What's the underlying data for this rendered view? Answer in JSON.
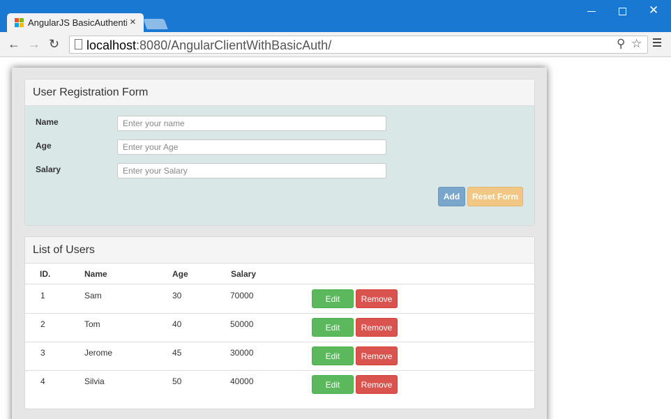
{
  "browser": {
    "tab_title": "AngularJS BasicAuthentication",
    "url_host": "localhost",
    "url_path": ":8080/AngularClientWithBasicAuth/"
  },
  "form": {
    "title": "User Registration Form",
    "fields": [
      {
        "label": "Name",
        "placeholder": "Enter your name",
        "value": ""
      },
      {
        "label": "Age",
        "placeholder": "Enter your Age",
        "value": ""
      },
      {
        "label": "Salary",
        "placeholder": "Enter your Salary",
        "value": ""
      }
    ],
    "add_label": "Add",
    "reset_label": "Reset Form"
  },
  "list": {
    "title": "List of Users",
    "columns": [
      "ID.",
      "Name",
      "Age",
      "Salary"
    ],
    "rows": [
      {
        "id": "1",
        "name": "Sam",
        "age": "30",
        "salary": "70000"
      },
      {
        "id": "2",
        "name": "Tom",
        "age": "40",
        "salary": "50000"
      },
      {
        "id": "3",
        "name": "Jerome",
        "age": "45",
        "salary": "30000"
      },
      {
        "id": "4",
        "name": "Silvia",
        "age": "50",
        "salary": "40000"
      }
    ],
    "edit_label": "Edit",
    "remove_label": "Remove"
  },
  "colors": {
    "titlebar": "#1979d2",
    "panel_body": "#d9e8e7",
    "add_button": "#7ba6cc",
    "reset_button": "#f0c785",
    "edit_button": "#5cb85c",
    "remove_button": "#d9534f"
  }
}
